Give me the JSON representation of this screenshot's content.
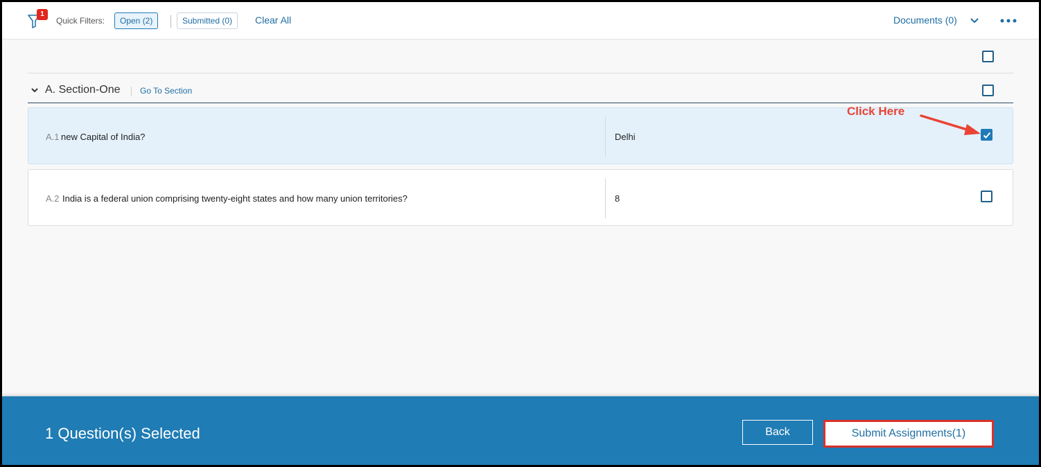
{
  "toolbar": {
    "filter_badge": "1",
    "quick_filters_label": "Quick Filters:",
    "chips": [
      {
        "label": "Open (2)",
        "active": true
      },
      {
        "label": "Submitted (0)",
        "active": false
      }
    ],
    "clear_all": "Clear All",
    "documents": "Documents (0)"
  },
  "section": {
    "title": "A. Section-One",
    "go_to": "Go To Section",
    "checked": false
  },
  "questions": [
    {
      "number": "A.1",
      "text": "new Capital of India?",
      "answer": "Delhi",
      "checked": true
    },
    {
      "number": "A.2",
      "text": "India is a federal union comprising twenty-eight states and how many union territories?",
      "answer": "8",
      "checked": false
    }
  ],
  "annotation": {
    "text": "Click Here",
    "color": "#ea4335"
  },
  "footer": {
    "selected_text": "1 Question(s) Selected",
    "back_label": "Back",
    "submit_label": "Submit Assignments(1)"
  },
  "colors": {
    "accent": "#1f7cb4",
    "link": "#1f6ea3",
    "badge": "#e0261f",
    "highlight_border": "#d9322a"
  }
}
